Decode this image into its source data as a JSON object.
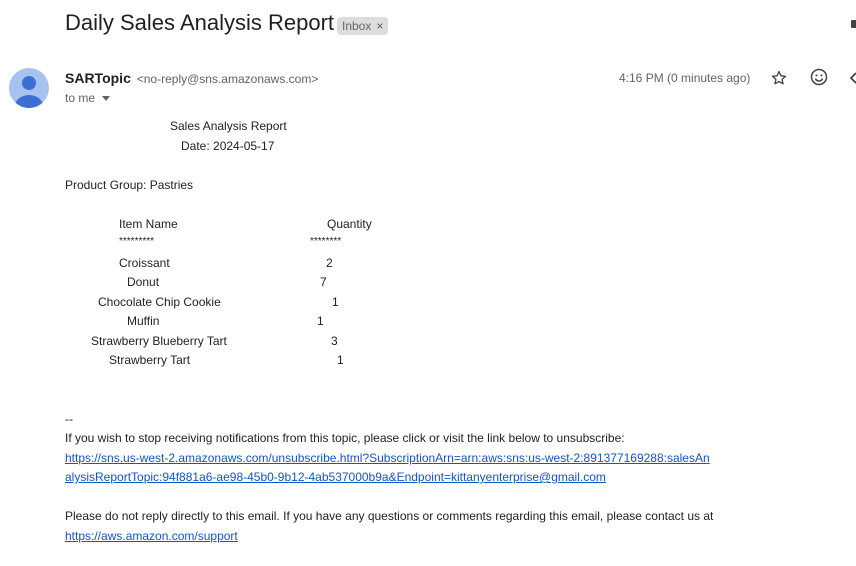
{
  "email": {
    "subject": "Daily Sales Analysis Report",
    "label_badge": "Inbox",
    "sender_name": "SARTopic",
    "sender_email": "<no-reply@sns.amazonaws.com>",
    "recipient_text": "to me",
    "timestamp": "4:16 PM (0 minutes ago)"
  },
  "report": {
    "title": "Sales Analysis Report",
    "date": "Date: 2024-05-17",
    "product_group": "Product Group: Pastries",
    "header_item": "Item Name",
    "header_qty": "Quantity",
    "sep_item": "*********",
    "sep_qty": "********",
    "rows": [
      {
        "item": "Croissant",
        "qty": "2"
      },
      {
        "item": "Donut",
        "qty": "7"
      },
      {
        "item": "Chocolate Chip Cookie",
        "qty": "1"
      },
      {
        "item": "Muffin",
        "qty": "1"
      },
      {
        "item": "Strawberry Blueberry Tart",
        "qty": "3"
      },
      {
        "item": "Strawberry Tart",
        "qty": "1"
      }
    ]
  },
  "footer": {
    "dashes": "--",
    "unsubscribe_text": "If you wish to stop receiving notifications from this topic, please click or visit the link below to unsubscribe:",
    "unsubscribe_link_line1": "https://sns.us-west-2.amazonaws.com/unsubscribe.html?SubscriptionArn=arn:aws:sns:us-west-2:891377169288:salesAn",
    "unsubscribe_link_line2": "alysisReportTopic:94f881a6-ae98-45b0-9b12-4ab537000b9a&Endpoint=kittanyenterprise@gmail.com",
    "noreply_text": "Please do not reply directly to this email. If you have any questions or comments regarding this email, please contact us at",
    "support_link": "https://aws.amazon.com/support"
  },
  "icons": {
    "star": "star-icon",
    "emoji": "emoji-icon",
    "reply": "reply-icon",
    "caret": "chevron-down-icon"
  },
  "colors": {
    "link": "#1155cc",
    "avatar_bg": "#a7c2f0",
    "avatar_fg": "#3b6fd4",
    "badge_bg": "#dddddd",
    "meta_text": "#5f6368"
  }
}
